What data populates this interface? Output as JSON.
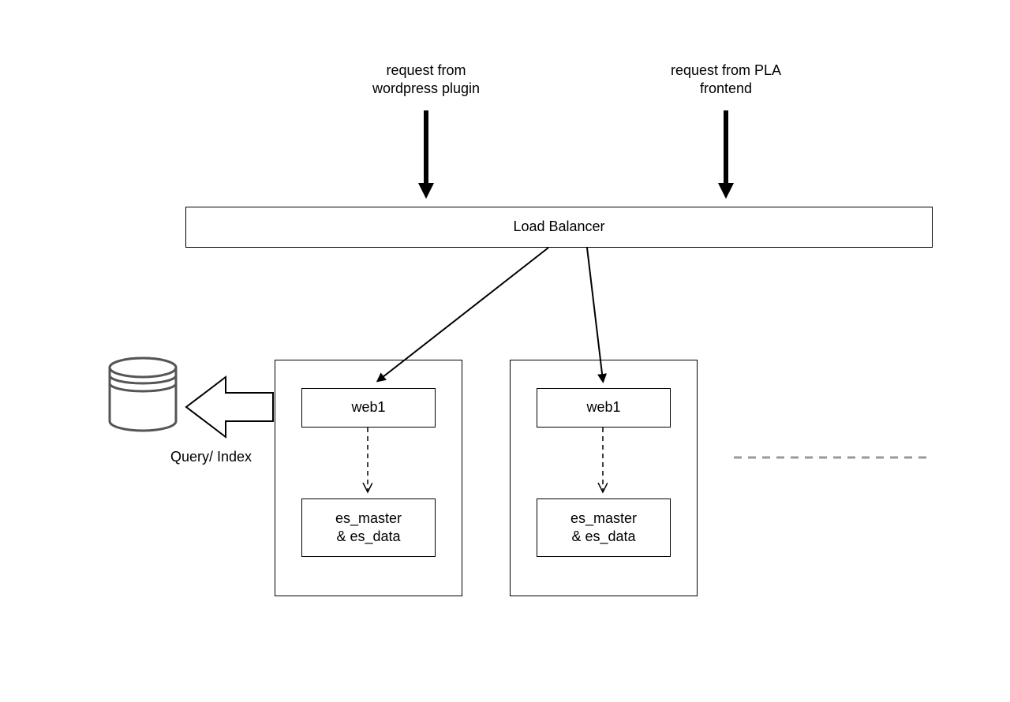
{
  "diagram": {
    "labels": {
      "request_wordpress_line1": "request from",
      "request_wordpress_line2": "wordpress plugin",
      "request_pla_line1": "request from PLA",
      "request_pla_line2": "frontend",
      "load_balancer": "Load Balancer",
      "query_index": "Query/ Index",
      "web1_left": "web1",
      "web1_right": "web1",
      "es_left_line1": "es_master",
      "es_left_line2": "& es_data",
      "es_right_line1": "es_master",
      "es_right_line2": "& es_data"
    },
    "nodes": [
      {
        "id": "request-wordpress-label",
        "type": "text"
      },
      {
        "id": "request-pla-label",
        "type": "text"
      },
      {
        "id": "load-balancer",
        "type": "box"
      },
      {
        "id": "database",
        "type": "cylinder"
      },
      {
        "id": "server-group-left",
        "type": "container"
      },
      {
        "id": "server-group-right",
        "type": "container"
      },
      {
        "id": "web1-left",
        "type": "box",
        "parent": "server-group-left"
      },
      {
        "id": "es-left",
        "type": "box",
        "parent": "server-group-left"
      },
      {
        "id": "web1-right",
        "type": "box",
        "parent": "server-group-right"
      },
      {
        "id": "es-right",
        "type": "box",
        "parent": "server-group-right"
      },
      {
        "id": "query-index-label",
        "type": "text"
      }
    ],
    "edges": [
      {
        "from": "request-wordpress-label",
        "to": "load-balancer",
        "style": "solid-thick",
        "arrow": "filled"
      },
      {
        "from": "request-pla-label",
        "to": "load-balancer",
        "style": "solid-thick",
        "arrow": "filled"
      },
      {
        "from": "load-balancer",
        "to": "web1-left",
        "style": "solid",
        "arrow": "filled"
      },
      {
        "from": "load-balancer",
        "to": "web1-right",
        "style": "solid",
        "arrow": "filled"
      },
      {
        "from": "web1-left",
        "to": "es-left",
        "style": "dashed",
        "arrow": "open"
      },
      {
        "from": "web1-right",
        "to": "es-right",
        "style": "dashed",
        "arrow": "open"
      },
      {
        "from": "server-group-left",
        "to": "database",
        "style": "hollow-block-arrow",
        "arrow": "hollow"
      },
      {
        "from": "server-group-right",
        "to": "continuation",
        "style": "dashed-gray",
        "arrow": "none"
      }
    ]
  }
}
